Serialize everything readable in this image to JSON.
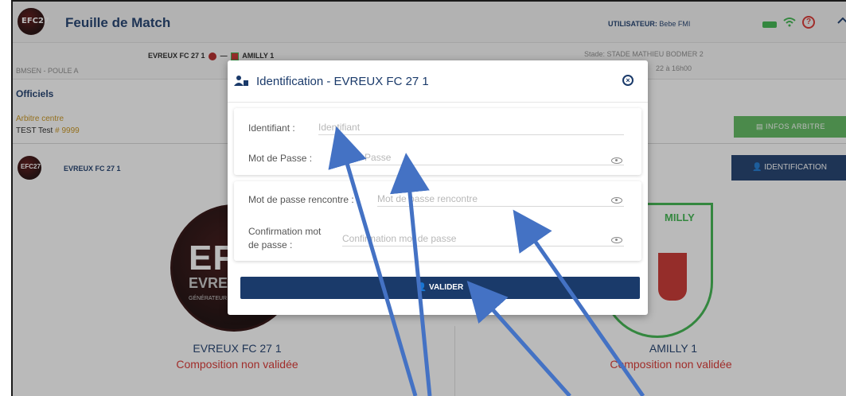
{
  "header": {
    "app_title": "Feuille de Match",
    "logo_text": "EFC27",
    "user_label": "UTILISATEUR:",
    "user_name": "Bebe FMI",
    "help_glyph": "?",
    "icons": [
      "battery-icon",
      "wifi-icon",
      "help-icon",
      "home-icon"
    ]
  },
  "match": {
    "home_team": "EVREUX FC 27 1",
    "separator": "—",
    "away_team": "AMILLY 1",
    "poule": "BMSEN - POULE A",
    "stade": "Stade: STADE MATHIEU BODMER 2",
    "date": "22 à 16h00"
  },
  "officials": {
    "title": "Officiels",
    "role": "Arbitre centre",
    "name": "TEST Test",
    "id": "# 9999",
    "infos_button": "INFOS ARBITRE"
  },
  "team_section": {
    "team_name": "EVREUX FC 27 1",
    "logo_text": "EFC27",
    "identification_button": "IDENTIFICATION"
  },
  "teams": {
    "left_name": "EVREUX FC 27 1",
    "left_status": "Composition non validée",
    "right_name": "AMILLY 1",
    "right_status": "Composition non validée",
    "left_logo_main": "EFC",
    "left_logo_sub": "EVREUX",
    "left_logo_tag": "GÉNÉRATEUR",
    "right_logo_text": "MILLY"
  },
  "modal": {
    "title": "Identification - EVREUX FC 27 1",
    "close_glyph": "×",
    "fields": [
      {
        "label": "Identifiant :",
        "placeholder": "Identifiant",
        "value": ""
      },
      {
        "label": "Mot de Passe :",
        "placeholder": "Mot de Passe",
        "value": ""
      },
      {
        "label": "Mot de passe rencontre :",
        "placeholder": "Mot de passe rencontre",
        "value": ""
      },
      {
        "label_line1": "Confirmation mot",
        "label_line2": "de passe :",
        "placeholder": "Confirmation mot de passe",
        "value": ""
      }
    ],
    "submit_label": "VALIDER"
  },
  "colors": {
    "primary": "#1a3a6a",
    "success": "#5cb85c",
    "danger": "#d9302c",
    "accent": "#c8931a",
    "annotation_arrow": "#4472c4"
  }
}
